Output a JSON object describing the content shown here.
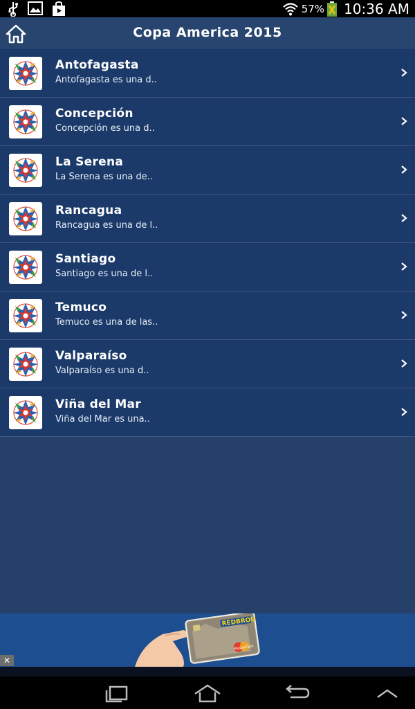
{
  "status_bar": {
    "battery_percent": "57%",
    "time": "10:36 AM",
    "icons": [
      "usb-icon",
      "image-icon",
      "shopping-bag-icon",
      "wifi-icon",
      "battery-icon"
    ]
  },
  "app_bar": {
    "title": "Copa America 2015",
    "home_icon": "home-icon"
  },
  "cities": [
    {
      "title": "Antofagasta",
      "subtitle": "Antofagasta es una d.."
    },
    {
      "title": "Concepción",
      "subtitle": "Concepción es una d.."
    },
    {
      "title": "La Serena",
      "subtitle": "La Serena es una de.."
    },
    {
      "title": "Rancagua",
      "subtitle": "Rancagua es una de l.."
    },
    {
      "title": "Santiago",
      "subtitle": "Santiago es una de l.."
    },
    {
      "title": "Temuco",
      "subtitle": "Temuco es una de las.."
    },
    {
      "title": "Valparaíso",
      "subtitle": "Valparaíso es una d.."
    },
    {
      "title": "Viña del Mar",
      "subtitle": "Viña del Mar es una.."
    }
  ],
  "ad": {
    "brand_text": "REDBROU",
    "card_text": "MasterCard",
    "close_label": "✕"
  },
  "nav_bar": {
    "icons": [
      "recent-apps-icon",
      "home-icon",
      "back-icon",
      "expand-icon"
    ]
  },
  "colors": {
    "app_bar": "#28456f",
    "row": "#1b3a69",
    "row_divider": "#3c5780",
    "empty_area": "#26406a",
    "ad_background": "#1d4e8f"
  }
}
